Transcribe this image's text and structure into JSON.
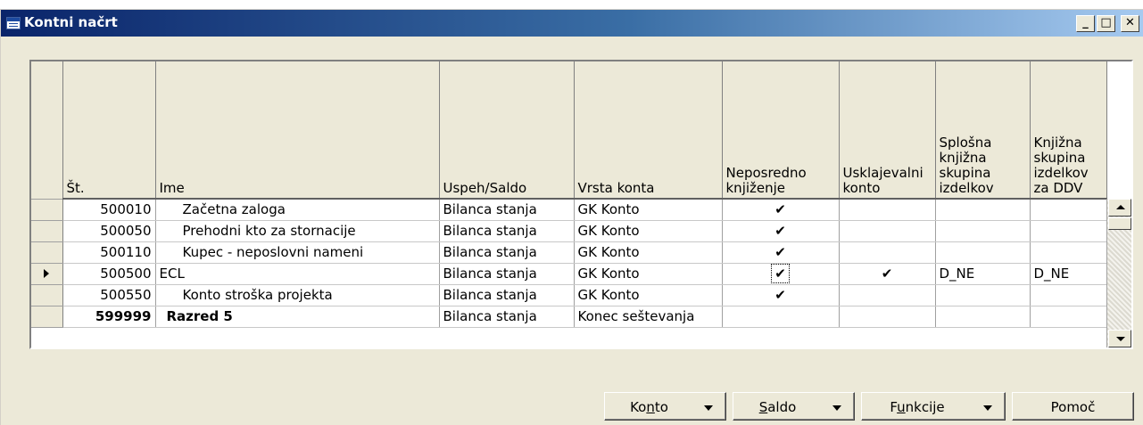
{
  "window": {
    "title": "Kontni načrt"
  },
  "controls": {
    "minimize": "_",
    "maximize": "□",
    "close": "✕"
  },
  "columns": {
    "st": "Št.",
    "ime": "Ime",
    "uspeh": "Uspeh/Saldo",
    "vrsta": "Vrsta konta",
    "neposredno": "Neposredno knjiženje",
    "usklajevalni": "Usklajevalni konto",
    "splosna": "Splošna knjižna skupina izdelkov",
    "knjizna": "Knjižna skupina izdelkov za DDV"
  },
  "rows": [
    {
      "st": "500010",
      "ime": "Začetna zaloga",
      "uspeh": "Bilanca stanja",
      "vrsta": "GK Konto",
      "neposredno": "✔",
      "usklajevalni": "",
      "splosna": "",
      "knjizna": ""
    },
    {
      "st": "500050",
      "ime": "Prehodni kto za stornacije",
      "uspeh": "Bilanca stanja",
      "vrsta": "GK Konto",
      "neposredno": "✔",
      "usklajevalni": "",
      "splosna": "",
      "knjizna": ""
    },
    {
      "st": "500110",
      "ime": "Kupec - neposlovni nameni",
      "uspeh": "Bilanca stanja",
      "vrsta": "GK Konto",
      "neposredno": "✔",
      "usklajevalni": "",
      "splosna": "",
      "knjizna": ""
    },
    {
      "st": "500500",
      "ime": "ECL",
      "uspeh": "Bilanca stanja",
      "vrsta": "GK Konto",
      "neposredno": "✔",
      "usklajevalni": "✔",
      "splosna": "D_NE",
      "knjizna": "D_NE"
    },
    {
      "st": "500550",
      "ime": "Konto stroška projekta",
      "uspeh": "Bilanca stanja",
      "vrsta": "GK Konto",
      "neposredno": "✔",
      "usklajevalni": "",
      "splosna": "",
      "knjizna": ""
    },
    {
      "st": "599999",
      "ime": "Razred 5",
      "uspeh": "Bilanca stanja",
      "vrsta": "Konec seštevanja",
      "neposredno": "",
      "usklajevalni": "",
      "splosna": "",
      "knjizna": ""
    }
  ],
  "buttons": {
    "konto_pre": "Ko",
    "konto_u": "n",
    "konto_post": "to",
    "saldo_u": "S",
    "saldo_post": "aldo",
    "funkcije_pre": "F",
    "funkcije_u": "u",
    "funkcije_post": "nkcije",
    "pomoc": "Pomoč"
  }
}
